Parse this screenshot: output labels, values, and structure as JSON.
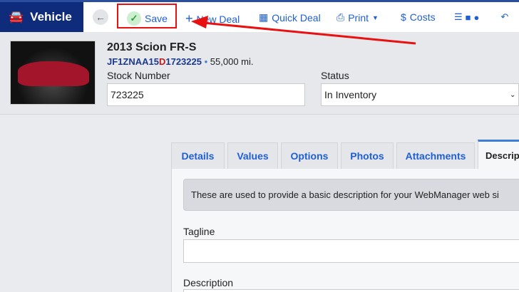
{
  "app": {
    "title": "Vehicle"
  },
  "toolbar": {
    "save": "Save",
    "new_deal": "New Deal",
    "quick_deal": "Quick Deal",
    "print": "Print",
    "costs": "Costs"
  },
  "vehicle": {
    "title": "2013 Scion FR-S",
    "vin_prefix": "JF1ZNAA15",
    "vin_highlight": "D",
    "vin_suffix": "1723225",
    "separator": "•",
    "mileage": "55,000 mi."
  },
  "fields": {
    "stock_label": "Stock Number",
    "stock_value": "723225",
    "status_label": "Status",
    "status_value": "In Inventory"
  },
  "tabs": [
    "Details",
    "Values",
    "Options",
    "Photos",
    "Attachments",
    "Descrip"
  ],
  "description": {
    "info": "These are used to provide a basic description for your WebManager web si",
    "tagline_label": "Tagline",
    "tagline_value": "",
    "description_label": "Description"
  },
  "colors": {
    "brand": "#0f2c7c",
    "link": "#1f5fd6",
    "annotation": "#e81010"
  }
}
